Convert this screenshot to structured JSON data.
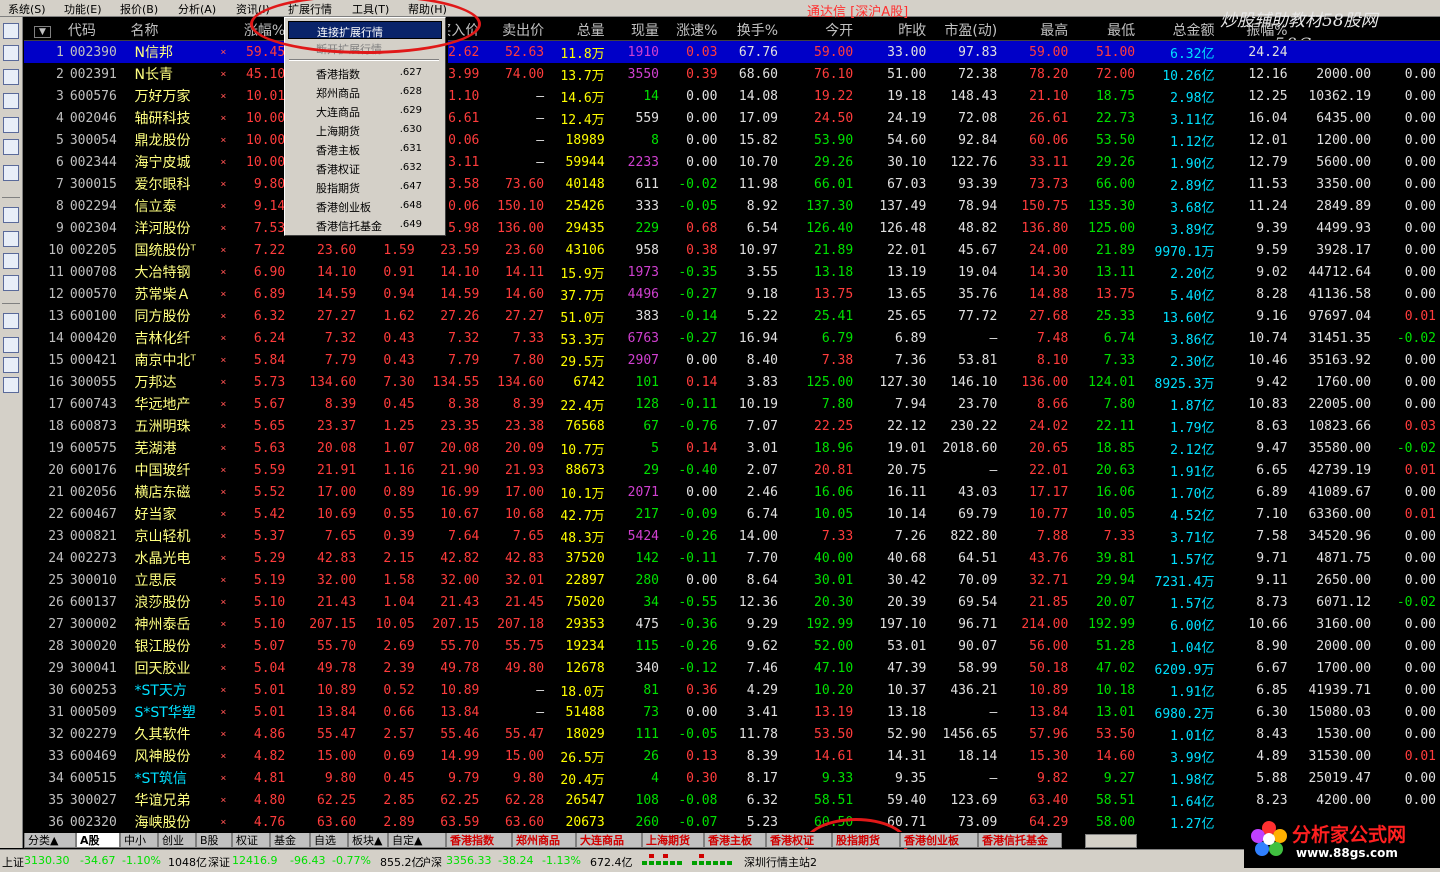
{
  "menu": [
    "系统(S)",
    "功能(E)",
    "报价(B)",
    "分析(A)",
    "扩展行情",
    "工具(T)",
    "资讯(I)",
    "帮助(H)"
  ],
  "title": "通达信 [深沪A股]",
  "watermark": {
    "line1": "炒股辅助教材58股网",
    "line2": "www.58Gu.com"
  },
  "columns": [
    "",
    "代码",
    "名称",
    "",
    "涨幅%",
    "现价",
    "涨跌",
    "买入价",
    "卖出价",
    "总量",
    "现量",
    "涨速%",
    "换手%",
    "今开",
    "昨收",
    "市盈(动)",
    "最高",
    "最低",
    "总金额",
    "振幅%",
    "",
    ""
  ],
  "dropdown": {
    "items": [
      {
        "label": "连接扩展行情",
        "code": "",
        "state": "highlighted"
      },
      {
        "label": "断开扩展行情",
        "code": "",
        "state": "disabled"
      },
      {
        "label": "香港指数",
        "code": ".627",
        "state": "normal"
      },
      {
        "label": "郑州商品",
        "code": ".628",
        "state": "normal"
      },
      {
        "label": "大连商品",
        "code": ".629",
        "state": "normal"
      },
      {
        "label": "上海期货",
        "code": ".630",
        "state": "normal"
      },
      {
        "label": "香港主板",
        "code": ".631",
        "state": "normal"
      },
      {
        "label": "香港权证",
        "code": ".632",
        "state": "normal"
      },
      {
        "label": "股指期货",
        "code": ".647",
        "state": "normal"
      },
      {
        "label": "香港创业板",
        "code": ".648",
        "state": "normal"
      },
      {
        "label": "香港信托基金",
        "code": ".649",
        "state": "normal"
      }
    ]
  },
  "rows": [
    [
      "1",
      "002390",
      "N信邦",
      "×",
      "59.45",
      "52.62",
      "19.62",
      "52.62",
      "52.63",
      "11.8万",
      "1910",
      "0.03",
      "67.76",
      "59.00",
      "33.00",
      "97.83",
      "59.00",
      "51.00",
      "6.32亿",
      "24.24",
      "",
      ""
    ],
    [
      "2",
      "002391",
      "N长青",
      "×",
      "45.10",
      "73.99",
      "23.00",
      "73.99",
      "74.00",
      "13.7万",
      "3550",
      "0.39",
      "68.60",
      "76.10",
      "51.00",
      "72.38",
      "78.20",
      "72.00",
      "10.26亿",
      "12.16",
      "2000.00",
      "0.00"
    ],
    [
      "3",
      "600576",
      "万好万家",
      "×",
      "10.01",
      "21.10",
      "1.92",
      "21.10",
      "—",
      "14.6万",
      "14",
      "0.00",
      "14.08",
      "19.22",
      "19.18",
      "148.43",
      "21.10",
      "18.75",
      "2.98亿",
      "12.25",
      "10362.19",
      "0.00"
    ],
    [
      "4",
      "002046",
      "轴研科技",
      "×",
      "10.00",
      "26.61",
      "2.42",
      "26.61",
      "—",
      "12.4万",
      "559",
      "0.00",
      "17.09",
      "24.50",
      "24.19",
      "72.08",
      "26.61",
      "22.73",
      "3.11亿",
      "16.04",
      "6435.00",
      "0.00"
    ],
    [
      "5",
      "300054",
      "鼎龙股份",
      "×",
      "10.00",
      "60.06",
      "5.46",
      "60.06",
      "—",
      "18989",
      "8",
      "0.00",
      "15.82",
      "53.90",
      "54.60",
      "92.84",
      "60.06",
      "53.50",
      "1.12亿",
      "12.01",
      "1200.00",
      "0.00"
    ],
    [
      "6",
      "002344",
      "海宁皮城",
      "×",
      "10.00",
      "33.11",
      "3.01",
      "33.11",
      "—",
      "59944",
      "2233",
      "0.00",
      "10.70",
      "29.26",
      "30.10",
      "122.76",
      "33.11",
      "29.26",
      "1.90亿",
      "12.79",
      "5600.00",
      "0.00"
    ],
    [
      "7",
      "300015",
      "爱尔眼科",
      "×",
      "9.80",
      "73.58",
      "6.55",
      "73.58",
      "73.60",
      "40148",
      "611",
      "-0.02",
      "11.98",
      "66.01",
      "67.03",
      "93.39",
      "73.73",
      "66.00",
      "2.89亿",
      "11.53",
      "3350.00",
      "0.00"
    ],
    [
      "8",
      "002294",
      "信立泰",
      "×",
      "9.14",
      "150.06",
      "12.57",
      "150.06",
      "150.10",
      "25426",
      "333",
      "-0.05",
      "8.92",
      "137.30",
      "137.49",
      "78.94",
      "150.75",
      "135.30",
      "3.68亿",
      "11.24",
      "2849.89",
      "0.00"
    ],
    [
      "9",
      "002304",
      "洋河股份",
      "×",
      "7.53",
      "135.98",
      "9.52",
      "135.98",
      "136.00",
      "29435",
      "229",
      "0.68",
      "6.54",
      "126.40",
      "126.48",
      "48.82",
      "136.80",
      "125.00",
      "3.89亿",
      "9.39",
      "4499.93",
      "0.00"
    ],
    [
      "10",
      "002205",
      "国统股份ᵀ",
      "×",
      "7.22",
      "23.60",
      "1.59",
      "23.59",
      "23.60",
      "43106",
      "958",
      "0.38",
      "10.97",
      "21.89",
      "22.01",
      "45.67",
      "24.00",
      "21.89",
      "9970.1万",
      "9.59",
      "3928.17",
      "0.00"
    ],
    [
      "11",
      "000708",
      "大冶特钢",
      "×",
      "6.90",
      "14.10",
      "0.91",
      "14.10",
      "14.11",
      "15.9万",
      "1973",
      "-0.35",
      "3.55",
      "13.18",
      "13.19",
      "19.04",
      "14.30",
      "13.11",
      "2.20亿",
      "9.02",
      "44712.64",
      "0.00"
    ],
    [
      "12",
      "000570",
      "苏常柴Ａ",
      "×",
      "6.89",
      "14.59",
      "0.94",
      "14.59",
      "14.60",
      "37.7万",
      "4496",
      "-0.27",
      "9.18",
      "13.75",
      "13.65",
      "35.76",
      "14.88",
      "13.75",
      "5.40亿",
      "8.28",
      "41136.58",
      "0.00"
    ],
    [
      "13",
      "600100",
      "同方股份",
      "×",
      "6.32",
      "27.27",
      "1.62",
      "27.26",
      "27.27",
      "51.0万",
      "383",
      "-0.14",
      "5.22",
      "25.41",
      "25.65",
      "77.72",
      "27.68",
      "25.33",
      "13.60亿",
      "9.16",
      "97697.04",
      "0.01"
    ],
    [
      "14",
      "000420",
      "吉林化纤",
      "×",
      "6.24",
      "7.32",
      "0.43",
      "7.32",
      "7.33",
      "53.3万",
      "6763",
      "-0.27",
      "16.94",
      "6.79",
      "6.89",
      "—",
      "7.48",
      "6.74",
      "3.86亿",
      "10.74",
      "31451.35",
      "-0.02"
    ],
    [
      "15",
      "000421",
      "南京中北ᵀ",
      "×",
      "5.84",
      "7.79",
      "0.43",
      "7.79",
      "7.80",
      "29.5万",
      "2907",
      "0.00",
      "8.40",
      "7.38",
      "7.36",
      "53.81",
      "8.10",
      "7.33",
      "2.30亿",
      "10.46",
      "35163.92",
      "0.00"
    ],
    [
      "16",
      "300055",
      "万邦达",
      "×",
      "5.73",
      "134.60",
      "7.30",
      "134.55",
      "134.60",
      "6742",
      "101",
      "0.14",
      "3.83",
      "125.00",
      "127.30",
      "146.10",
      "136.00",
      "124.01",
      "8925.3万",
      "9.42",
      "1760.00",
      "0.00"
    ],
    [
      "17",
      "600743",
      "华远地产",
      "×",
      "5.67",
      "8.39",
      "0.45",
      "8.38",
      "8.39",
      "22.4万",
      "128",
      "-0.11",
      "10.19",
      "7.80",
      "7.94",
      "23.70",
      "8.66",
      "7.80",
      "1.87亿",
      "10.83",
      "22005.00",
      "0.00"
    ],
    [
      "18",
      "600873",
      "五洲明珠",
      "×",
      "5.65",
      "23.37",
      "1.25",
      "23.35",
      "23.38",
      "76568",
      "67",
      "-0.76",
      "7.07",
      "22.25",
      "22.12",
      "230.22",
      "24.02",
      "22.11",
      "1.79亿",
      "8.63",
      "10823.66",
      "0.03"
    ],
    [
      "19",
      "600575",
      "芜湖港",
      "×",
      "5.63",
      "20.08",
      "1.07",
      "20.08",
      "20.09",
      "10.7万",
      "5",
      "0.14",
      "3.01",
      "18.96",
      "19.01",
      "2018.60",
      "20.65",
      "18.85",
      "2.12亿",
      "9.47",
      "35580.00",
      "-0.02"
    ],
    [
      "20",
      "600176",
      "中国玻纤",
      "×",
      "5.59",
      "21.91",
      "1.16",
      "21.90",
      "21.93",
      "88673",
      "29",
      "-0.40",
      "2.07",
      "20.81",
      "20.75",
      "—",
      "22.01",
      "20.63",
      "1.91亿",
      "6.65",
      "42739.19",
      "0.01"
    ],
    [
      "21",
      "002056",
      "横店东磁",
      "×",
      "5.52",
      "17.00",
      "0.89",
      "16.99",
      "17.00",
      "10.1万",
      "2071",
      "0.00",
      "2.46",
      "16.06",
      "16.11",
      "43.03",
      "17.17",
      "16.06",
      "1.70亿",
      "6.89",
      "41089.67",
      "0.00"
    ],
    [
      "22",
      "600467",
      "好当家",
      "×",
      "5.42",
      "10.69",
      "0.55",
      "10.67",
      "10.68",
      "42.7万",
      "217",
      "-0.09",
      "6.74",
      "10.05",
      "10.14",
      "69.79",
      "10.77",
      "10.05",
      "4.52亿",
      "7.10",
      "63360.00",
      "0.01"
    ],
    [
      "23",
      "000821",
      "京山轻机",
      "×",
      "5.37",
      "7.65",
      "0.39",
      "7.64",
      "7.65",
      "48.3万",
      "5424",
      "-0.26",
      "14.00",
      "7.33",
      "7.26",
      "822.80",
      "7.88",
      "7.33",
      "3.71亿",
      "7.58",
      "34520.96",
      "0.00"
    ],
    [
      "24",
      "002273",
      "水晶光电",
      "×",
      "5.29",
      "42.83",
      "2.15",
      "42.82",
      "42.83",
      "37520",
      "142",
      "-0.11",
      "7.70",
      "40.00",
      "40.68",
      "64.51",
      "43.76",
      "39.81",
      "1.57亿",
      "9.71",
      "4871.75",
      "0.00"
    ],
    [
      "25",
      "300010",
      "立思辰",
      "×",
      "5.19",
      "32.00",
      "1.58",
      "32.00",
      "32.01",
      "22897",
      "280",
      "0.00",
      "8.64",
      "30.01",
      "30.42",
      "70.09",
      "32.71",
      "29.94",
      "7231.4万",
      "9.11",
      "2650.00",
      "0.00"
    ],
    [
      "26",
      "600137",
      "浪莎股份",
      "×",
      "5.10",
      "21.43",
      "1.04",
      "21.43",
      "21.45",
      "75020",
      "34",
      "-0.55",
      "12.36",
      "20.30",
      "20.39",
      "69.54",
      "21.85",
      "20.07",
      "1.57亿",
      "8.73",
      "6071.12",
      "-0.02"
    ],
    [
      "27",
      "300002",
      "神州泰岳",
      "×",
      "5.10",
      "207.15",
      "10.05",
      "207.15",
      "207.18",
      "29353",
      "475",
      "-0.36",
      "9.29",
      "192.99",
      "197.10",
      "96.71",
      "214.00",
      "192.99",
      "6.00亿",
      "10.66",
      "3160.00",
      "0.00"
    ],
    [
      "28",
      "300020",
      "银江股份",
      "×",
      "5.07",
      "55.70",
      "2.69",
      "55.70",
      "55.75",
      "19234",
      "115",
      "-0.26",
      "9.62",
      "52.00",
      "53.01",
      "90.07",
      "56.00",
      "51.28",
      "1.04亿",
      "8.90",
      "2000.00",
      "0.00"
    ],
    [
      "29",
      "300041",
      "回天胶业",
      "×",
      "5.04",
      "49.78",
      "2.39",
      "49.78",
      "49.80",
      "12678",
      "340",
      "-0.12",
      "7.46",
      "47.10",
      "47.39",
      "58.99",
      "50.18",
      "47.02",
      "6209.9万",
      "6.67",
      "1700.00",
      "0.00"
    ],
    [
      "30",
      "600253",
      "*ST天方",
      "×",
      "5.01",
      "10.89",
      "0.52",
      "10.89",
      "—",
      "18.0万",
      "81",
      "0.36",
      "4.29",
      "10.20",
      "10.37",
      "436.21",
      "10.89",
      "10.18",
      "1.91亿",
      "6.85",
      "41939.71",
      "0.00"
    ],
    [
      "31",
      "000509",
      "S*ST华塑",
      "×",
      "5.01",
      "13.84",
      "0.66",
      "13.84",
      "—",
      "51488",
      "73",
      "0.00",
      "3.41",
      "13.19",
      "13.18",
      "—",
      "13.84",
      "13.01",
      "6980.2万",
      "6.30",
      "15080.03",
      "0.00"
    ],
    [
      "32",
      "002279",
      "久其软件",
      "×",
      "4.86",
      "55.47",
      "2.57",
      "55.46",
      "55.47",
      "18029",
      "111",
      "-0.05",
      "11.78",
      "53.50",
      "52.90",
      "1456.65",
      "57.96",
      "53.50",
      "1.01亿",
      "8.43",
      "1530.00",
      "0.00"
    ],
    [
      "33",
      "600469",
      "风神股份",
      "×",
      "4.82",
      "15.00",
      "0.69",
      "14.99",
      "15.00",
      "26.5万",
      "26",
      "0.13",
      "8.39",
      "14.61",
      "14.31",
      "18.14",
      "15.30",
      "14.60",
      "3.99亿",
      "4.89",
      "31530.00",
      "0.01"
    ],
    [
      "34",
      "600515",
      "*ST筑信",
      "×",
      "4.81",
      "9.80",
      "0.45",
      "9.79",
      "9.80",
      "20.4万",
      "4",
      "0.30",
      "8.17",
      "9.33",
      "9.35",
      "—",
      "9.82",
      "9.27",
      "1.98亿",
      "5.88",
      "25019.47",
      "0.00"
    ],
    [
      "35",
      "300027",
      "华谊兄弟",
      "×",
      "4.80",
      "62.25",
      "2.85",
      "62.25",
      "62.28",
      "26547",
      "108",
      "-0.08",
      "6.32",
      "58.51",
      "59.40",
      "123.69",
      "63.40",
      "58.51",
      "1.64亿",
      "8.23",
      "4200.00",
      "0.00"
    ],
    [
      "36",
      "002320",
      "海峡股份",
      "×",
      "4.76",
      "63.60",
      "2.89",
      "63.59",
      "63.60",
      "20673",
      "260",
      "-0.07",
      "5.23",
      "60.50",
      "60.71",
      "73.09",
      "64.29",
      "58.00",
      "1.27亿",
      "10.36",
      "3400.00",
      "0.00"
    ]
  ],
  "tabs": [
    {
      "label": "分类▲",
      "style": "plain"
    },
    {
      "label": "A股",
      "style": "active"
    },
    {
      "label": "中小",
      "style": "plain"
    },
    {
      "label": "创业",
      "style": "plain"
    },
    {
      "label": "B股",
      "style": "plain"
    },
    {
      "label": "权证",
      "style": "plain"
    },
    {
      "label": "基金",
      "style": "plain"
    },
    {
      "label": "自选",
      "style": "plain"
    },
    {
      "label": "板块▲",
      "style": "plain"
    },
    {
      "label": "自定▲",
      "style": "plain"
    },
    {
      "label": "香港指数",
      "style": "red"
    },
    {
      "label": "郑州商品",
      "style": "red"
    },
    {
      "label": "大连商品",
      "style": "red"
    },
    {
      "label": "上海期货",
      "style": "red"
    },
    {
      "label": "香港主板",
      "style": "red"
    },
    {
      "label": "香港权证",
      "style": "red"
    },
    {
      "label": "股指期货",
      "style": "red"
    },
    {
      "label": "香港创业板",
      "style": "red"
    },
    {
      "label": "香港信托基金",
      "style": "red"
    }
  ],
  "status": {
    "sh_label": "上证",
    "sh_value": "3130.30",
    "sh_chg": "-34.67",
    "sh_pct": "-1.10%",
    "sh_amt": "1048亿",
    "sz_label": "深证",
    "sz_value": "12416.9",
    "sz_chg": "-96.43",
    "sz_pct": "-0.77%",
    "sz_amt": "855.2亿",
    "hs_label": "沪深",
    "hs_value": "3356.33",
    "hs_chg": "-38.24",
    "hs_pct": "-1.13%",
    "hs_amt": "672.4亿",
    "server": "深圳行情主站2"
  },
  "logo": {
    "text1": "分析家公式网",
    "text2": "www.88gs.com"
  },
  "colors": {
    "up": "#ff3c3c",
    "down": "#00e000",
    "name": "#ffff80",
    "volume": "#ffff00",
    "amount": "#00e0ff",
    "current_vol": "#d040d0",
    "selection": "#0000c8",
    "circle": "#e01818"
  }
}
